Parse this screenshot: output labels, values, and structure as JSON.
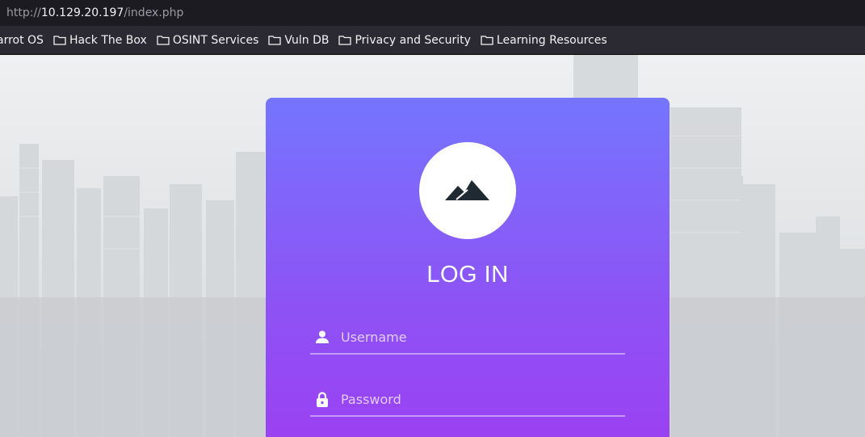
{
  "browser": {
    "url_prefix": "http://",
    "url_host": "10.129.20.197",
    "url_path": "/index.php"
  },
  "bookmarks": [
    {
      "label": "arrot OS",
      "icon": "none"
    },
    {
      "label": "Hack The Box",
      "icon": "folder-icon"
    },
    {
      "label": "OSINT Services",
      "icon": "folder-icon"
    },
    {
      "label": "Vuln DB",
      "icon": "folder-icon"
    },
    {
      "label": "Privacy and Security",
      "icon": "folder-icon"
    },
    {
      "label": "Learning Resources",
      "icon": "folder-icon"
    }
  ],
  "login": {
    "logo_icon": "mountain-icon",
    "title": "LOG IN",
    "username_placeholder": "Username",
    "username_value": "",
    "password_placeholder": "Password",
    "password_value": "",
    "username_icon": "user-icon",
    "password_icon": "lock-icon"
  },
  "colors": {
    "card_top": "#7575ff",
    "card_bottom": "#9b40f2",
    "toolbar": "#2b2a33"
  }
}
